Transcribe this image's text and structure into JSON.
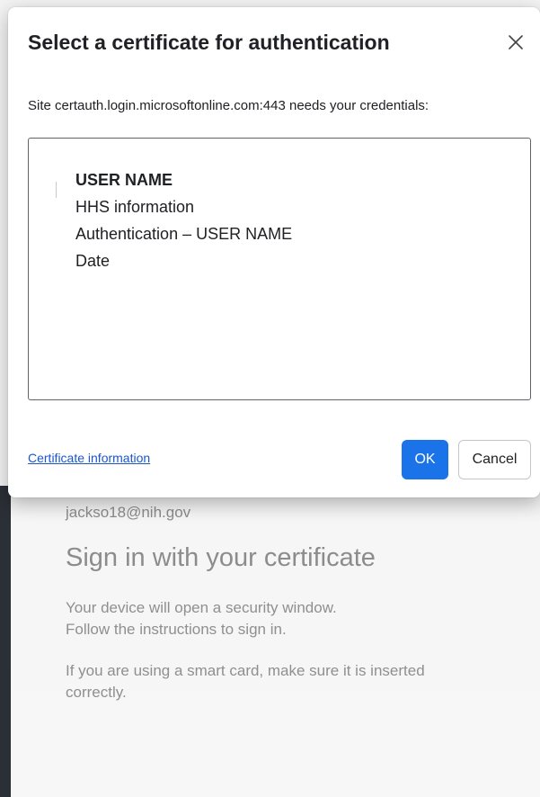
{
  "background": {
    "email": "jackso18@nih.gov",
    "heading": "Sign in with your certificate",
    "paragraph1": [
      "Your device will open a security window.",
      "Follow the instructions to sign in."
    ],
    "paragraph2": [
      "If you are using a smart card, make sure it is inserted",
      "correctly."
    ]
  },
  "dialog": {
    "title": "Select a certificate for authentication",
    "close_icon": "close-icon",
    "site_message": "Site certauth.login.microsoftonline.com:443 needs your credentials:",
    "certificates": [
      {
        "name": "USER NAME",
        "issuer": "HHS information",
        "purpose": "Authentication – USER NAME",
        "date": "Date"
      }
    ],
    "certificate_info_link": "Certificate information",
    "ok_label": "OK",
    "cancel_label": "Cancel"
  },
  "colors": {
    "accent": "#1a73e8",
    "link": "#1a56c9",
    "sidebar": "#2b2f36"
  }
}
